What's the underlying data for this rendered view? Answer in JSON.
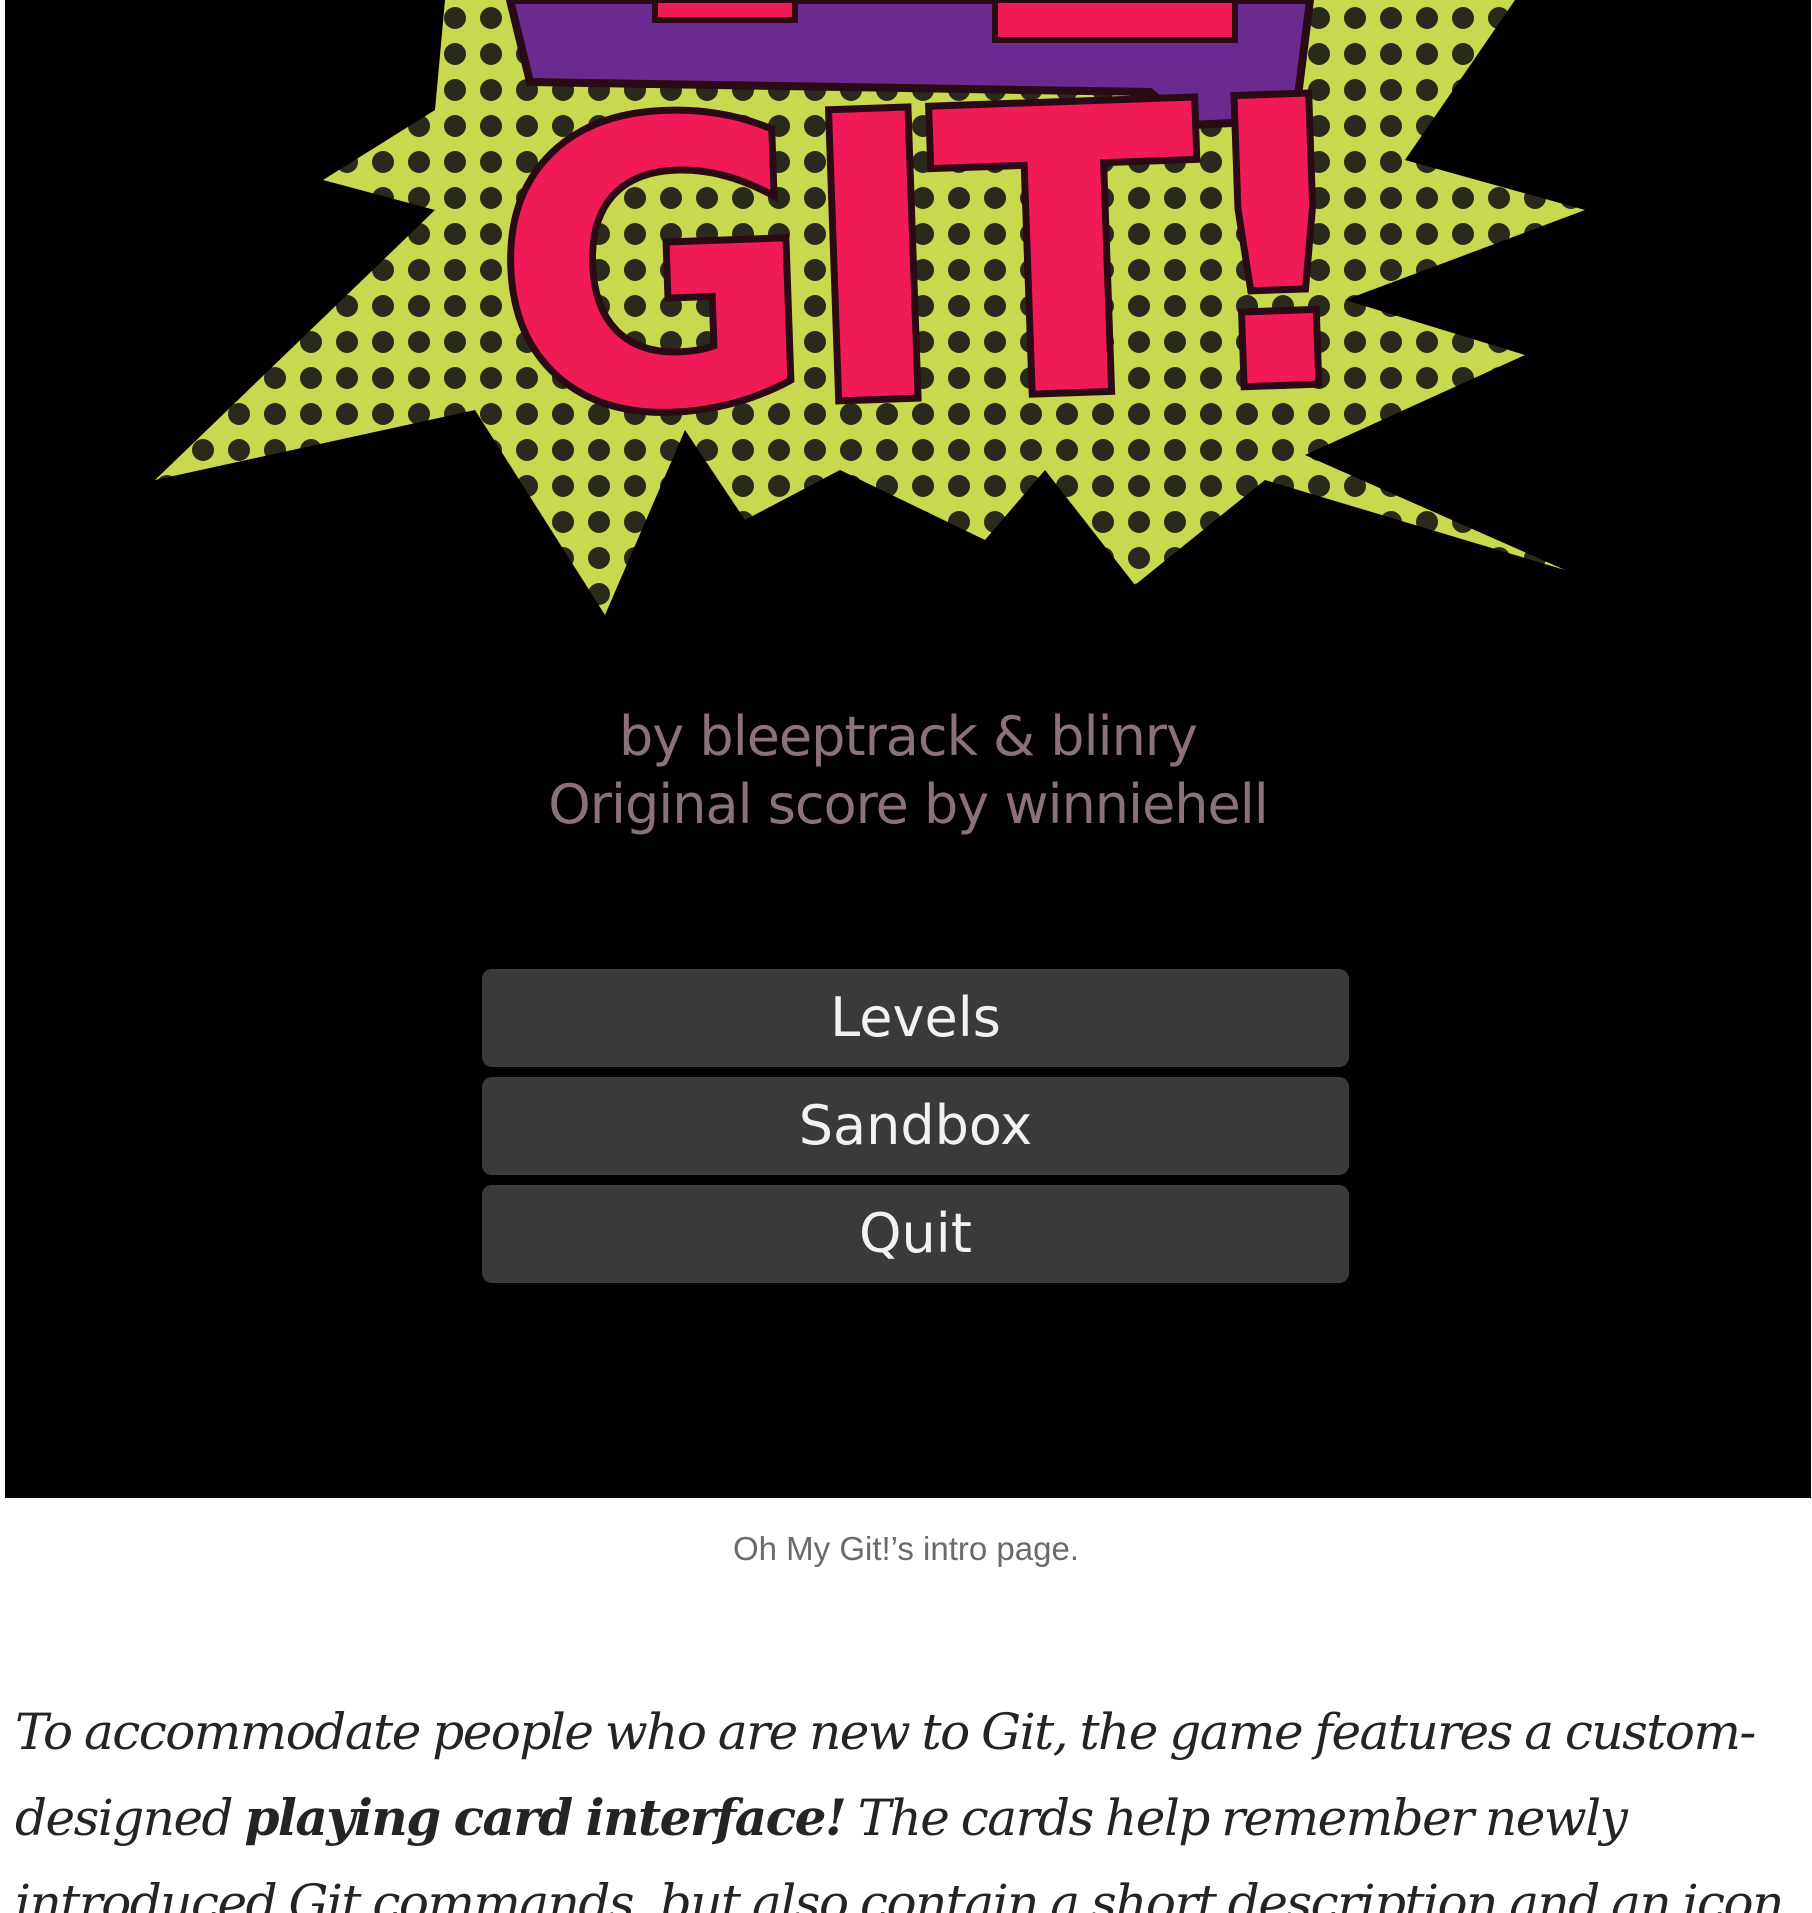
{
  "game": {
    "logo_text": "GIT!",
    "credits_line1": "by bleeptrack & blinry",
    "credits_line2": "Original score by winniehell",
    "menu": [
      {
        "label": "Levels"
      },
      {
        "label": "Sandbox"
      },
      {
        "label": "Quit"
      }
    ],
    "colors": {
      "background": "#000000",
      "burst": "#c9d94f",
      "banner": "#6a2a8f",
      "logo_letters": "#ef1a56",
      "button": "#3a3a3a",
      "credits": "#8a7278"
    }
  },
  "caption": "Oh My Git!’s intro page.",
  "article": {
    "text_before": "To accommodate people who are new to Git, the game features a custom-designed ",
    "bold": "playing card interface!",
    "text_after": " The cards help remember newly introduced Git commands, but also contain a short description and an icon"
  }
}
